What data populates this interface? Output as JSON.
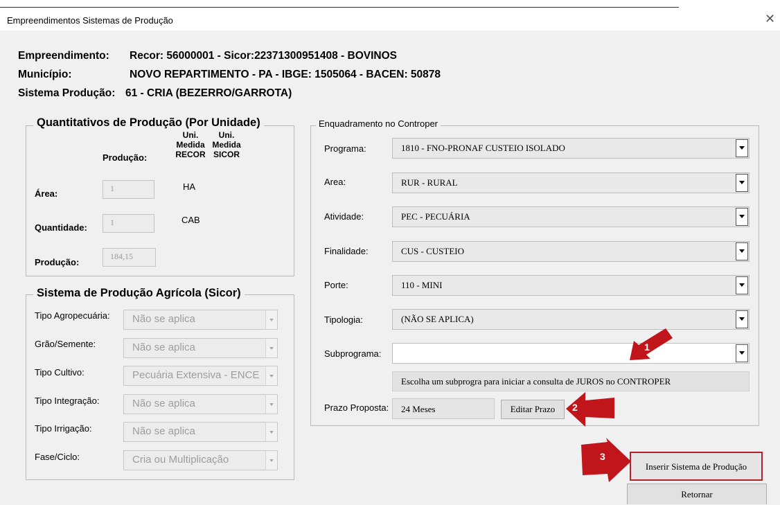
{
  "window": {
    "title": "Empreendimentos  Sistemas de Produção",
    "close_icon": "close-icon"
  },
  "header": {
    "empreendimento_label": "Empreendimento:",
    "empreendimento_value": "Recor: 56000001 - Sicor:22371300951408 - BOVINOS",
    "municipio_label": "Município:",
    "municipio_value": "NOVO REPARTIMENTO - PA - IBGE: 1505064 - BACEN: 50878",
    "sistema_label": "Sistema Produção:",
    "sistema_value": "61 - CRIA (BEZERRO/GARROTA)"
  },
  "quantitativos": {
    "legend": "Quantitativos de Produção (Por Unidade)",
    "col_producao": "Produção:",
    "col_uni_recor": "Uni. Medida RECOR",
    "col_uni_sicor": "Uni. Medida SICOR",
    "area_label": "Área:",
    "area_value": "1",
    "area_unit": "HA",
    "quantidade_label": "Quantidade:",
    "quantidade_value": "1",
    "quantidade_unit": "CAB",
    "producao_label": "Produção:",
    "producao_value": "184,15"
  },
  "sicor": {
    "legend": "Sistema de Produção Agrícola (Sicor)",
    "rows": [
      {
        "label": "Tipo Agropecuária:",
        "value": "Não se aplica"
      },
      {
        "label": "Grão/Semente:",
        "value": "Não se aplica"
      },
      {
        "label": "Tipo Cultivo:",
        "value": "Pecuária Extensiva - ENCE"
      },
      {
        "label": "Tipo Integração:",
        "value": "Não se aplica"
      },
      {
        "label": "Tipo Irrigação:",
        "value": "Não se aplica"
      },
      {
        "label": "Fase/Ciclo:",
        "value": "Cria ou Multiplicação"
      }
    ]
  },
  "controper": {
    "legend": "Enquadramento no Controper",
    "rows": [
      {
        "label": "Programa:",
        "value": "1810 - FNO-PRONAF CUSTEIO ISOLADO"
      },
      {
        "label": "Area:",
        "value": "RUR - RURAL"
      },
      {
        "label": "Atividade:",
        "value": "PEC - PECUÁRIA"
      },
      {
        "label": "Finalidade:",
        "value": "CUS - CUSTEIO"
      },
      {
        "label": "Porte:",
        "value": "110 - MINI"
      },
      {
        "label": "Tipologia:",
        "value": "(NÃO SE APLICA)"
      },
      {
        "label": "Subprograma:",
        "value": ""
      }
    ],
    "info_message": "Escolha um subprogra para iniciar a consulta de JUROS no CONTROPER",
    "prazo_label": "Prazo Proposta:",
    "prazo_value": "24 Meses",
    "editar_prazo": "Editar Prazo"
  },
  "actions": {
    "inserir": "Inserir Sistema de Produção",
    "retornar": "Retornar"
  },
  "annotations": {
    "one": "1",
    "two": "2",
    "three": "3",
    "color": "#c0161b",
    "highlight": "#b5202a"
  }
}
